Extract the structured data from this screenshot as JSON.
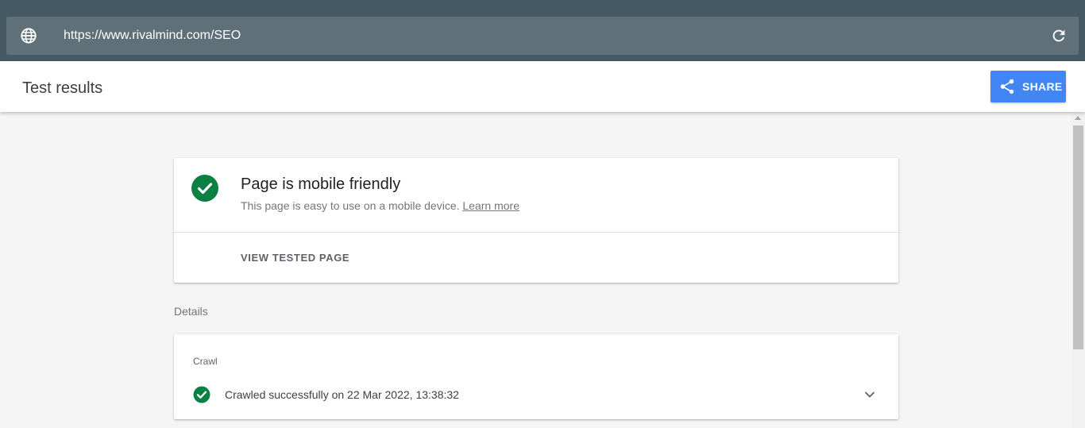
{
  "address_bar": {
    "url": "https://www.rivalmind.com/SEO",
    "globe_icon": "globe-icon",
    "reload_icon": "reload-icon"
  },
  "header": {
    "title": "Test results",
    "share_label": "SHARE",
    "share_icon": "share-icon"
  },
  "result": {
    "title": "Page is mobile friendly",
    "description": "This page is easy to use on a mobile device.",
    "learn_more": "Learn more",
    "view_tested_page": "VIEW TESTED PAGE",
    "status_icon": "check-circle-icon"
  },
  "details": {
    "label": "Details",
    "crawl": {
      "label": "Crawl",
      "status": "Crawled successfully on 22 Mar 2022, 13:38:32",
      "expand_icon": "chevron-down-icon"
    }
  },
  "colors": {
    "topbar": "#455a64",
    "accent": "#4285f4",
    "success": "#0b8043"
  }
}
